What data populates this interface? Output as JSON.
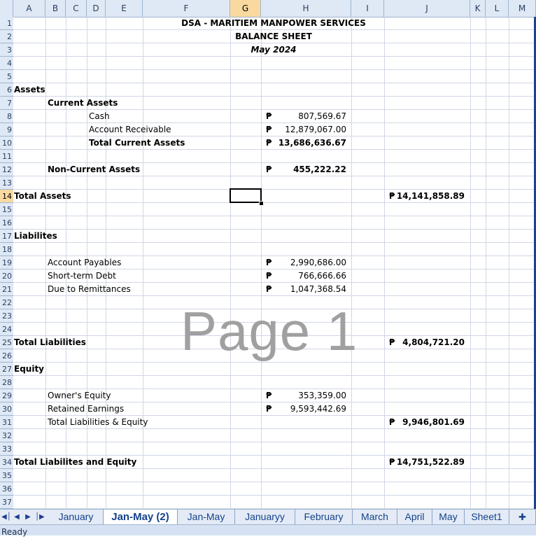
{
  "columns": [
    "A",
    "B",
    "C",
    "D",
    "E",
    "F",
    "G",
    "H",
    "I",
    "J",
    "K",
    "L",
    "M"
  ],
  "selected_column": "G",
  "selected_row": "14",
  "rows": [
    "1",
    "2",
    "3",
    "4",
    "5",
    "6",
    "7",
    "8",
    "9",
    "10",
    "11",
    "12",
    "13",
    "14",
    "15",
    "16",
    "17",
    "18",
    "19",
    "20",
    "21",
    "22",
    "23",
    "24",
    "25",
    "26",
    "27",
    "28",
    "29",
    "30",
    "31",
    "32",
    "33",
    "34",
    "35",
    "36",
    "37"
  ],
  "sheet": {
    "title": "DSA - MARITIEM MANPOWER SERVICES",
    "subtitle": "BALANCE SHEET",
    "period": "May 2024",
    "assets": {
      "label": "Assets",
      "current_label": "Current Assets",
      "cash_label": "Cash",
      "cash_value": "807,569.67",
      "ar_label": "Account Receivable",
      "ar_value": "12,879,067.00",
      "total_current_label": "Total Current Assets",
      "total_current_value": "13,686,636.67",
      "noncurrent_label": "Non-Current Assets",
      "noncurrent_value": "455,222.22",
      "total_label": "Total Assets",
      "total_value": "14,141,858.89"
    },
    "liabilities": {
      "label": "Liabilites",
      "ap_label": "Account Payables",
      "ap_value": "2,990,686.00",
      "std_label": "Short-term Debt",
      "std_value": "766,666.66",
      "remit_label": "Due to Remittances",
      "remit_value": "1,047,368.54",
      "total_label": "Total Liabilities",
      "total_value": "4,804,721.20"
    },
    "equity": {
      "label": "Equity",
      "owner_label": "Owner's Equity",
      "owner_value": "353,359.00",
      "retained_label": "Retained Earnings",
      "retained_value": "9,593,442.69",
      "total_le_label": "Total Liabilities & Equity",
      "total_le_value": "9,946,801.69"
    },
    "grand_total_label": "Total Liabilites and Equity",
    "grand_total_value": "14,751,522.89",
    "currency_symbol": "₱"
  },
  "watermark": "Page 1",
  "tabs": [
    "January",
    "Jan-May (2)",
    "Jan-May",
    "Januaryy",
    "February",
    "March",
    "April",
    "May",
    "Sheet1"
  ],
  "active_tab": "Jan-May (2)",
  "nav_icons": [
    "first-sheet-icon",
    "prev-sheet-icon",
    "next-sheet-icon",
    "last-sheet-icon"
  ],
  "status": "Ready"
}
